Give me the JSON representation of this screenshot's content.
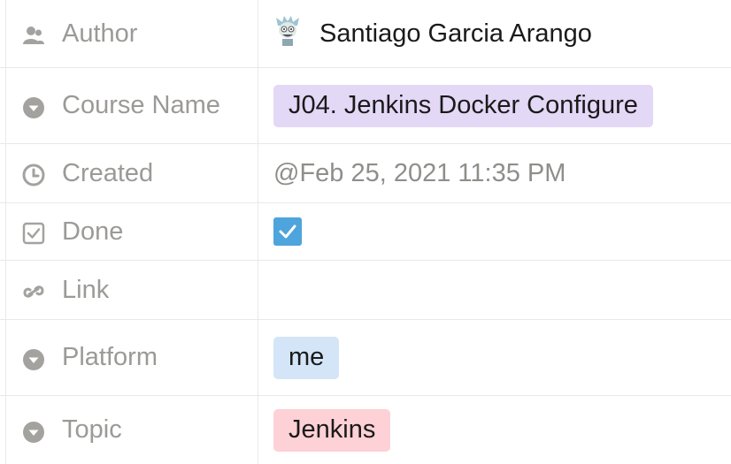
{
  "properties": {
    "author": {
      "label": "Author",
      "value": "Santiago Garcia Arango",
      "icon": "person-icon"
    },
    "course_name": {
      "label": "Course Name",
      "value": "J04. Jenkins Docker Configure",
      "icon": "select-icon",
      "tag_color": "#e3d8f6"
    },
    "created": {
      "label": "Created",
      "value": "@Feb 25, 2021 11:35 PM",
      "icon": "clock-icon"
    },
    "done": {
      "label": "Done",
      "checked": true,
      "icon": "checkbox-icon",
      "check_color": "#4ea4dc"
    },
    "link": {
      "label": "Link",
      "value": "",
      "icon": "link-icon"
    },
    "platform": {
      "label": "Platform",
      "value": "me",
      "icon": "select-icon",
      "tag_color": "#d3e5f7"
    },
    "topic": {
      "label": "Topic",
      "value": "Jenkins",
      "icon": "select-icon",
      "tag_color": "#fdd1d5"
    }
  }
}
